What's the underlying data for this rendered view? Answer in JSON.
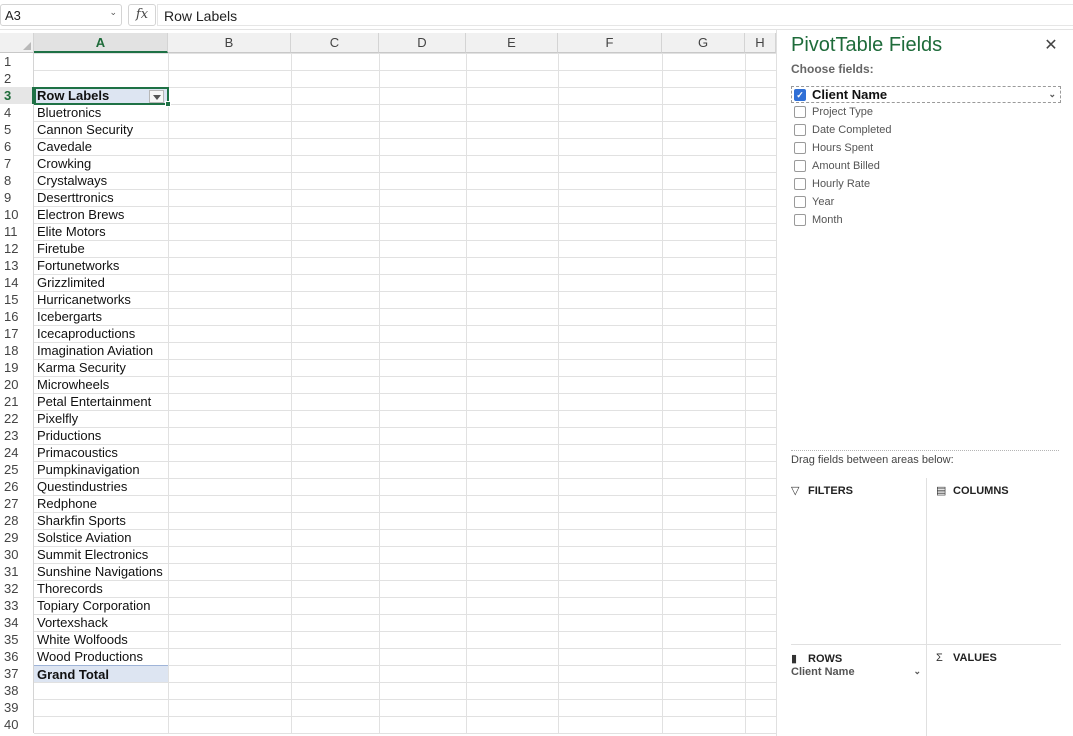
{
  "formula_bar": {
    "name_box": "A3",
    "fx_label": "fx",
    "content": "Row Labels"
  },
  "grid": {
    "columns": [
      "A",
      "B",
      "C",
      "D",
      "E",
      "F",
      "G",
      "H"
    ],
    "selected_column": "A",
    "selected_row": "3",
    "row_numbers": [
      "1",
      "2",
      "3",
      "4",
      "5",
      "6",
      "7",
      "8",
      "9",
      "10",
      "11",
      "12",
      "13",
      "14",
      "15",
      "16",
      "17",
      "18",
      "19",
      "20",
      "21",
      "22",
      "23",
      "24",
      "25",
      "26",
      "27",
      "28",
      "29",
      "30",
      "31",
      "32",
      "33",
      "34",
      "35",
      "36",
      "37",
      "38",
      "39",
      "40"
    ],
    "header_cell": "Row Labels",
    "clients": [
      "Bluetronics",
      "Cannon Security",
      "Cavedale",
      "Crowking",
      "Crystalways",
      "Deserttronics",
      "Electron Brews",
      "Elite Motors",
      "Firetube",
      "Fortunetworks",
      "Grizzlimited",
      "Hurricanetworks",
      "Icebergarts",
      "Icecaproductions",
      "Imagination Aviation",
      "Karma Security",
      "Microwheels",
      "Petal Entertainment",
      "Pixelfly",
      "Priductions",
      "Primacoustics",
      "Pumpkinavigation",
      "Questindustries",
      "Redphone",
      "Sharkfin Sports",
      "Solstice Aviation",
      "Summit Electronics",
      "Sunshine Navigations",
      "Thorecords",
      "Topiary Corporation",
      "Vortexshack",
      "White Wolfoods",
      "Wood Productions"
    ],
    "grand_total": "Grand Total"
  },
  "pivot_pane": {
    "title": "PivotTable Fields",
    "close_icon": "close-icon",
    "choose_fields": "Choose fields:",
    "fields": [
      {
        "label": "Client Name",
        "checked": true
      },
      {
        "label": "Project Type",
        "checked": false
      },
      {
        "label": "Date Completed",
        "checked": false
      },
      {
        "label": "Hours Spent",
        "checked": false
      },
      {
        "label": "Amount Billed",
        "checked": false
      },
      {
        "label": "Hourly Rate",
        "checked": false
      },
      {
        "label": "Year",
        "checked": false
      },
      {
        "label": "Month",
        "checked": false
      }
    ],
    "drag_hint": "Drag fields between areas below:",
    "areas": {
      "filters": "FILTERS",
      "columns": "COLUMNS",
      "rows": "ROWS",
      "values": "VALUES"
    },
    "rows_items": [
      "Client Name"
    ]
  },
  "colors": {
    "accent_green": "#1e6b3a",
    "selection_fill": "#dde5f2",
    "checkbox_blue": "#2f6fd6"
  }
}
